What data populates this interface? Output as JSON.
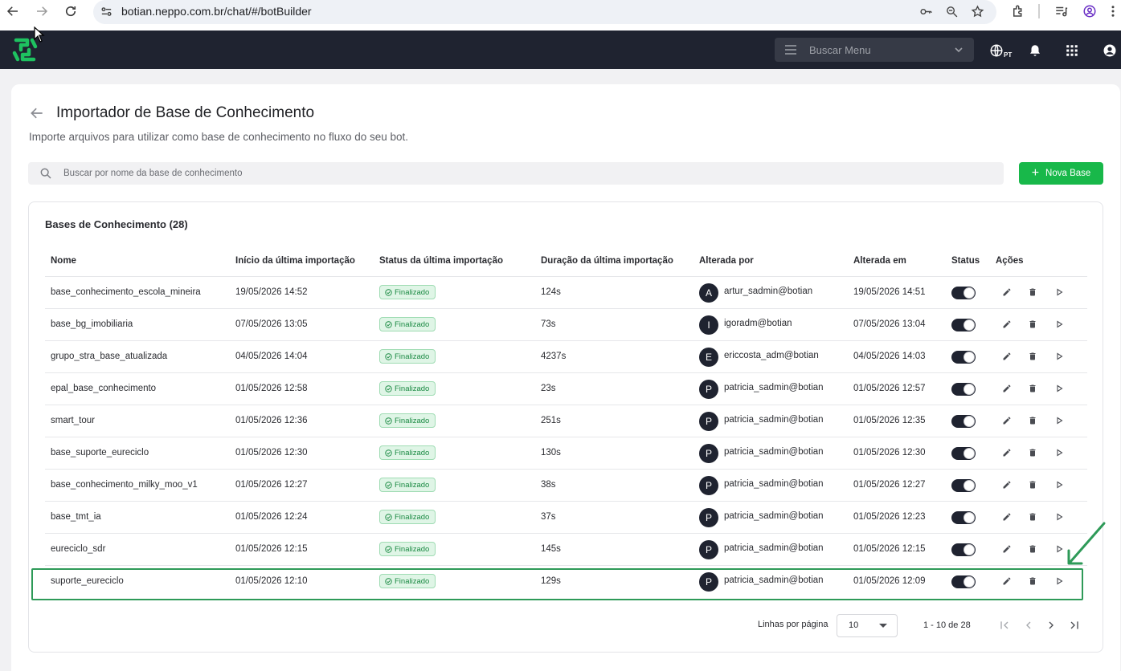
{
  "browser": {
    "url": "botian.neppo.com.br/chat/#/botBuilder"
  },
  "header": {
    "menu_search_placeholder": "Buscar Menu",
    "language_code": "PT"
  },
  "page": {
    "title": "Importador de Base de Conhecimento",
    "subtitle": "Importe arquivos para utilizar como base de conhecimento no fluxo do seu bot.",
    "search_placeholder": "Buscar por nome da base de conhecimento",
    "new_button_label": "Nova Base"
  },
  "table": {
    "title": "Bases de Conhecimento (28)",
    "columns": {
      "name": "Nome",
      "start": "Início da última importação",
      "status": "Status da última importação",
      "duration": "Duração da última importação",
      "changed_by": "Alterada por",
      "changed_at": "Alterada em",
      "active": "Status",
      "actions": "Ações"
    },
    "rows": [
      {
        "name": "base_conhecimento_escola_mineira",
        "start": "19/05/2026 14:52",
        "status": "Finalizado",
        "duration": "124s",
        "initial": "A",
        "user": "artur_sadmin@botian",
        "changed_at": "19/05/2026 14:51"
      },
      {
        "name": "base_bg_imobiliaria",
        "start": "07/05/2026 13:05",
        "status": "Finalizado",
        "duration": "73s",
        "initial": "I",
        "user": "igoradm@botian",
        "changed_at": "07/05/2026 13:04"
      },
      {
        "name": "grupo_stra_base_atualizada",
        "start": "04/05/2026 14:04",
        "status": "Finalizado",
        "duration": "4237s",
        "initial": "E",
        "user": "ericcosta_adm@botian",
        "changed_at": "04/05/2026 14:03"
      },
      {
        "name": "epal_base_conhecimento",
        "start": "01/05/2026 12:58",
        "status": "Finalizado",
        "duration": "23s",
        "initial": "P",
        "user": "patricia_sadmin@botian",
        "changed_at": "01/05/2026 12:57"
      },
      {
        "name": "smart_tour",
        "start": "01/05/2026 12:36",
        "status": "Finalizado",
        "duration": "251s",
        "initial": "P",
        "user": "patricia_sadmin@botian",
        "changed_at": "01/05/2026 12:35"
      },
      {
        "name": "base_suporte_eureciclo",
        "start": "01/05/2026 12:30",
        "status": "Finalizado",
        "duration": "130s",
        "initial": "P",
        "user": "patricia_sadmin@botian",
        "changed_at": "01/05/2026 12:30"
      },
      {
        "name": "base_conhecimento_milky_moo_v1",
        "start": "01/05/2026 12:27",
        "status": "Finalizado",
        "duration": "38s",
        "initial": "P",
        "user": "patricia_sadmin@botian",
        "changed_at": "01/05/2026 12:27"
      },
      {
        "name": "base_tmt_ia",
        "start": "01/05/2026 12:24",
        "status": "Finalizado",
        "duration": "37s",
        "initial": "P",
        "user": "patricia_sadmin@botian",
        "changed_at": "01/05/2026 12:23"
      },
      {
        "name": "eureciclo_sdr",
        "start": "01/05/2026 12:15",
        "status": "Finalizado",
        "duration": "145s",
        "initial": "P",
        "user": "patricia_sadmin@botian",
        "changed_at": "01/05/2026 12:15"
      },
      {
        "name": "suporte_eureciclo",
        "start": "01/05/2026 12:10",
        "status": "Finalizado",
        "duration": "129s",
        "initial": "P",
        "user": "patricia_sadmin@botian",
        "changed_at": "01/05/2026 12:09"
      }
    ]
  },
  "pagination": {
    "rows_per_page_label": "Linhas por página",
    "rows_per_page_value": "10",
    "range": "1 - 10 de 28"
  },
  "colors": {
    "header_bg": "#1f2330",
    "accent_green": "#18b84a",
    "badge_bg": "#dff5e6",
    "highlight_border": "#2e9a58"
  }
}
